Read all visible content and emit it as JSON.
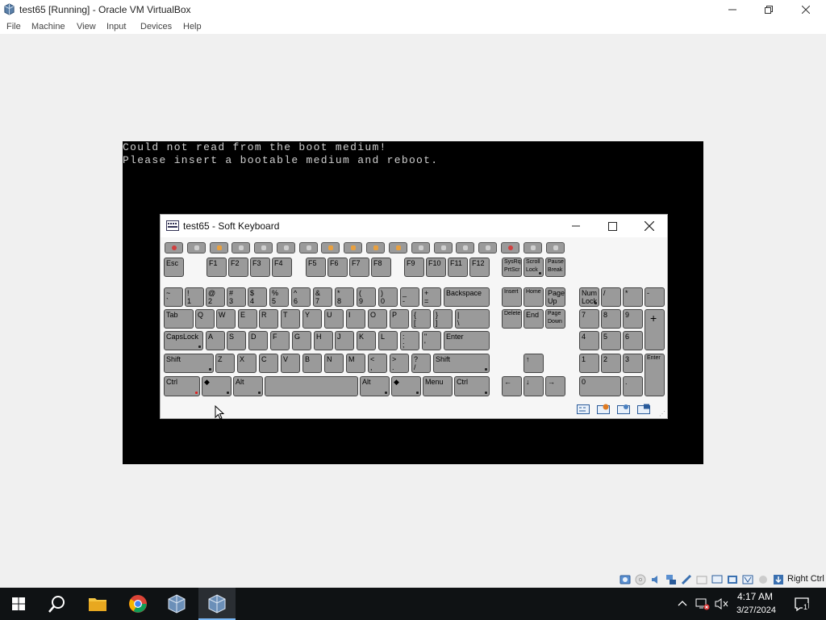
{
  "window": {
    "title": "test65 [Running] - Oracle VM VirtualBox"
  },
  "menu": [
    "File",
    "Machine",
    "View",
    "Input",
    "Devices",
    "Help"
  ],
  "console": {
    "lines": [
      "Could not read from the boot medium!",
      "Please insert a bootable medium and reboot."
    ]
  },
  "soft_keyboard": {
    "title": "test65 - Soft Keyboard",
    "keys": {
      "esc": "Esc",
      "f1": "F1",
      "f2": "F2",
      "f3": "F3",
      "f4": "F4",
      "f5": "F5",
      "f6": "F6",
      "f7": "F7",
      "f8": "F8",
      "f9": "F9",
      "f10": "F10",
      "f11": "F11",
      "f12": "F12",
      "sysrq_1": "SysRq",
      "sysrq_2": "PrtScr",
      "scroll_1": "Scroll",
      "scroll_2": "Lock",
      "pause_1": "Pause",
      "pause_2": "Break",
      "tilde_1": "~",
      "tilde_2": "`",
      "n1_1": "!",
      "n1_2": "1",
      "n2_1": "@",
      "n2_2": "2",
      "n3_1": "#",
      "n3_2": "3",
      "n4_1": "$",
      "n4_2": "4",
      "n5_1": "%",
      "n5_2": "5",
      "n6_1": "^",
      "n6_2": "6",
      "n7_1": "&",
      "n7_2": "7",
      "n8_1": "*",
      "n8_2": "8",
      "n9_1": "(",
      "n9_2": "9",
      "n0_1": ")",
      "n0_2": "0",
      "minus_1": "_",
      "minus_2": "-",
      "equal_1": "+",
      "equal_2": "=",
      "backspace": "Backspace",
      "insert": "Insert",
      "home": "Home",
      "pageup_1": "Page",
      "pageup_2": "Up",
      "numlock_1": "Num",
      "numlock_2": "Lock",
      "kp_div": "/",
      "kp_mul": "*",
      "kp_sub": "-",
      "tab": "Tab",
      "q": "Q",
      "w": "W",
      "e": "E",
      "r": "R",
      "t": "T",
      "y": "Y",
      "u": "U",
      "i": "I",
      "o": "O",
      "p": "P",
      "lbracket_1": "{",
      "lbracket_2": "[",
      "rbracket_1": "}",
      "rbracket_2": "]",
      "backslash_1": "|",
      "backslash_2": "\\",
      "delete": "Delete",
      "end": "End",
      "pagedown_1": "Page",
      "pagedown_2": "Down",
      "kp7": "7",
      "kp8": "8",
      "kp9": "9",
      "kp_add": "+",
      "capslock": "CapsLock",
      "a": "A",
      "s": "S",
      "d": "D",
      "f": "F",
      "g": "G",
      "h": "H",
      "j": "J",
      "k": "K",
      "l": "L",
      "semicolon_1": ":",
      "semicolon_2": ";",
      "quote_1": "\"",
      "quote_2": "'",
      "enter": "Enter",
      "kp4": "4",
      "kp5": "5",
      "kp6": "6",
      "lshift": "Shift",
      "z": "Z",
      "x": "X",
      "c": "C",
      "v": "V",
      "b": "B",
      "n": "N",
      "m": "M",
      "comma_1": "<",
      "comma_2": ",",
      "period_1": ">",
      "period_2": ".",
      "slash_1": "?",
      "slash_2": "/",
      "rshift": "Shift",
      "up": "↑",
      "kp1": "1",
      "kp2": "2",
      "kp3": "3",
      "kp_enter": "Enter",
      "lctrl": "Ctrl",
      "lwin": "◆",
      "lalt": "Alt",
      "ralt": "Alt",
      "rwin": "◆",
      "menu": "Menu",
      "rctrl": "Ctrl",
      "left": "←",
      "down": "↓",
      "right": "→",
      "kp0": "0",
      "kp_dot": "."
    }
  },
  "statusbar": {
    "host_key": "Right Ctrl"
  },
  "taskbar": {
    "time": "4:17 AM",
    "date": "3/27/2024",
    "notification_count": "1"
  },
  "colors": {
    "key_fill": "#9a9a9a",
    "vm_screen": "#000000",
    "console_text": "#d0d0d0",
    "taskbar": "#0f1214"
  }
}
